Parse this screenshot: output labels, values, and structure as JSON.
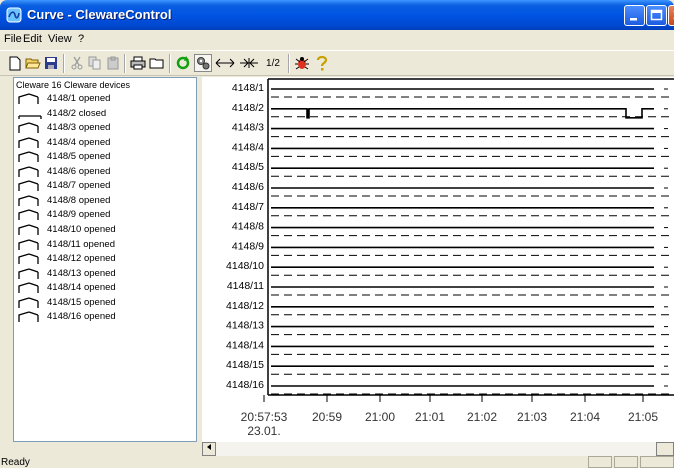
{
  "window": {
    "title": "Curve - ClewareControl"
  },
  "menu": [
    "File",
    "Edit",
    "View",
    "?"
  ],
  "toolbar": {
    "icons": [
      "new-icon",
      "open-icon",
      "save-icon",
      "cut-icon",
      "copy-icon",
      "paste-icon",
      "print-icon",
      "folder-icon",
      "refresh-icon",
      "cleware-icon",
      "expand-icon",
      "compress-icon",
      "half-icon",
      "bug-icon",
      "help-icon"
    ],
    "half_label": "1/2"
  },
  "tree": {
    "root": "Cleware 16 Cleware devices",
    "devices": [
      {
        "id": "4148/1",
        "state": "opened"
      },
      {
        "id": "4148/2",
        "state": "closed"
      },
      {
        "id": "4148/3",
        "state": "opened"
      },
      {
        "id": "4148/4",
        "state": "opened"
      },
      {
        "id": "4148/5",
        "state": "opened"
      },
      {
        "id": "4148/6",
        "state": "opened"
      },
      {
        "id": "4148/7",
        "state": "opened"
      },
      {
        "id": "4148/8",
        "state": "opened"
      },
      {
        "id": "4148/9",
        "state": "opened"
      },
      {
        "id": "4148/10",
        "state": "opened"
      },
      {
        "id": "4148/11",
        "state": "opened"
      },
      {
        "id": "4148/12",
        "state": "opened"
      },
      {
        "id": "4148/13",
        "state": "opened"
      },
      {
        "id": "4148/14",
        "state": "opened"
      },
      {
        "id": "4148/15",
        "state": "opened"
      },
      {
        "id": "4148/16",
        "state": "opened"
      }
    ]
  },
  "curve": {
    "channels": [
      "4148/1",
      "4148/2",
      "4148/3",
      "4148/4",
      "4148/5",
      "4148/6",
      "4148/7",
      "4148/8",
      "4148/9",
      "4148/10",
      "4148/11",
      "4148/12",
      "4148/13",
      "4148/14",
      "4148/15",
      "4148/16"
    ],
    "time_ticks": [
      "20:57:53",
      "20:59",
      "21:00",
      "21:01",
      "21:02",
      "21:03",
      "21:04",
      "21:05"
    ],
    "date_label": "23.01."
  },
  "status": {
    "text": "Ready"
  }
}
